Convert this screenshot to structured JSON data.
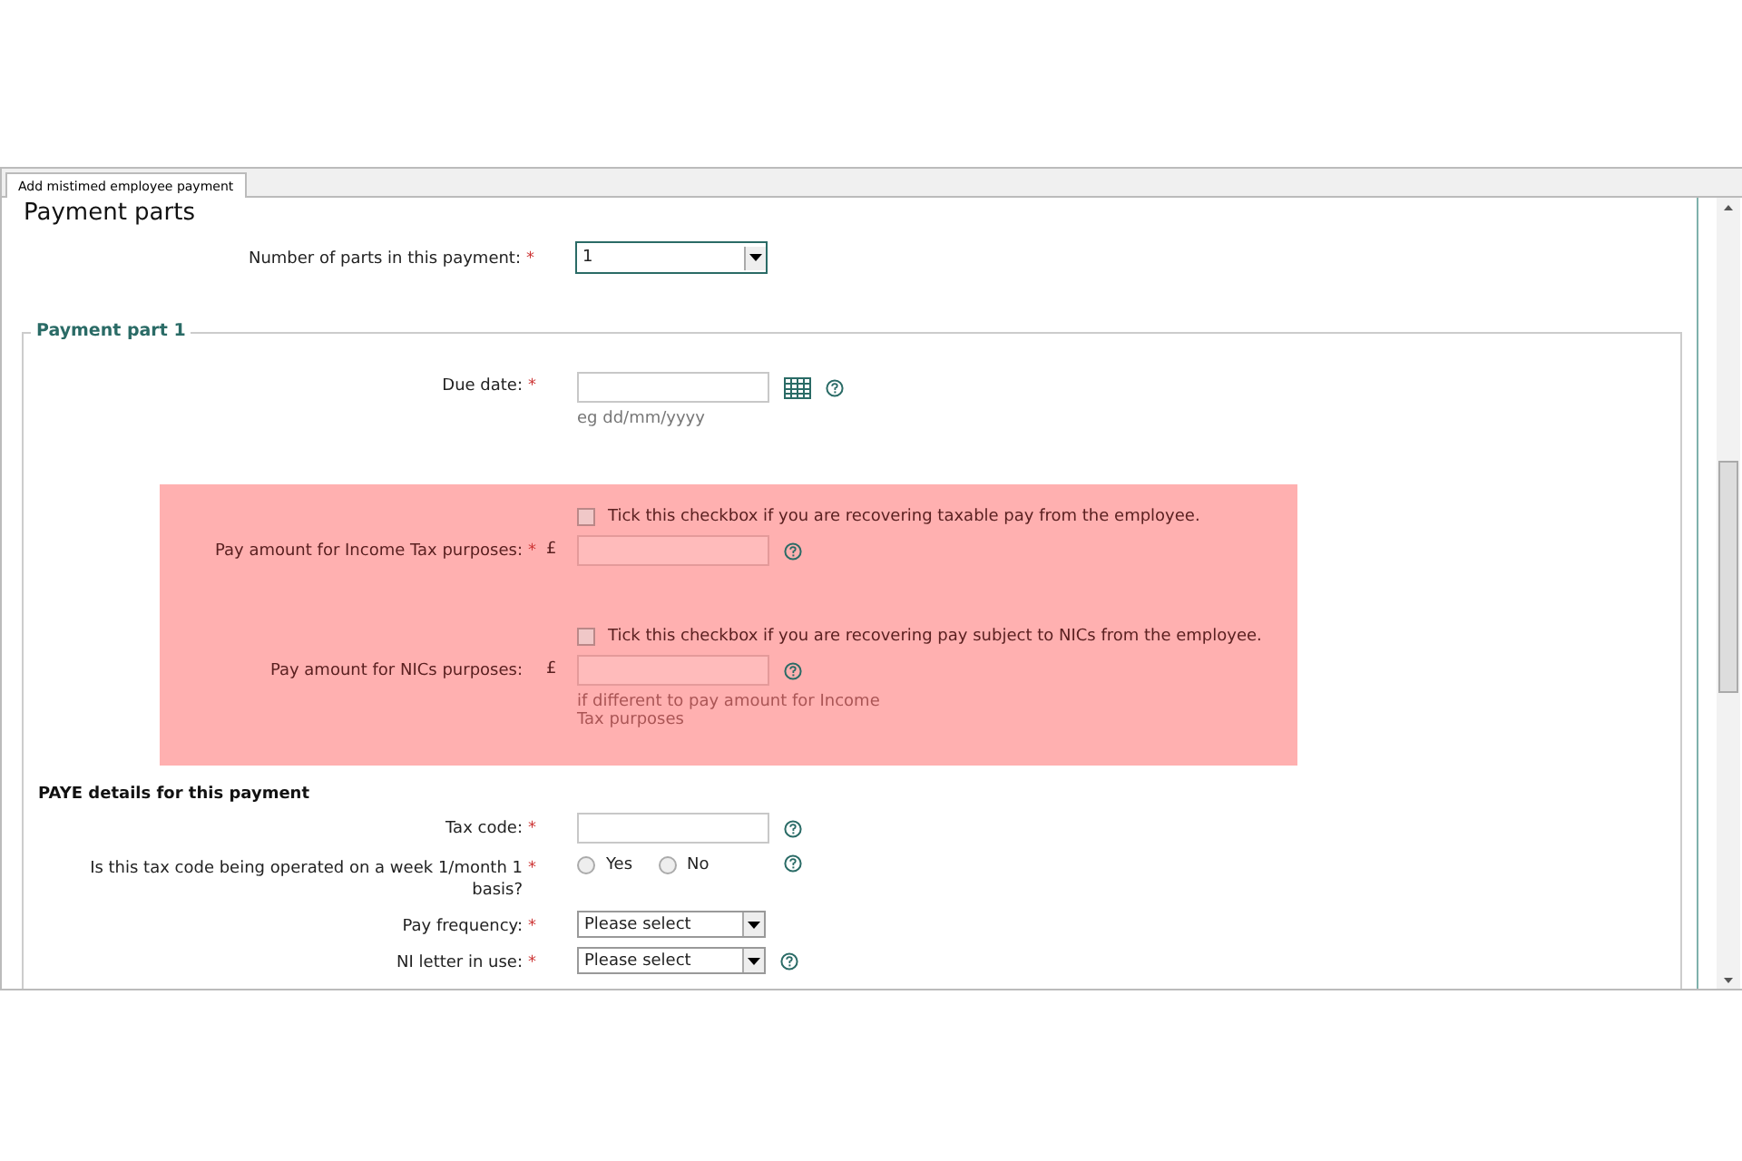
{
  "tab": {
    "label": "Add mistimed employee payment",
    "selected": true
  },
  "heading": "Payment parts",
  "parts_count": {
    "label": "Number of parts in this payment:",
    "required_mark": "*",
    "value": "1"
  },
  "payment_part": {
    "legend": "Payment part 1",
    "due_date": {
      "label": "Due date:",
      "required_mark": "*",
      "hint": "eg dd/mm/yyyy"
    },
    "pay_amounts": [
      {
        "checkbox_label": "Tick this checkbox if you are recovering taxable pay from the employee.",
        "checked": false,
        "label": "Pay amount for Income Tax purposes:",
        "required_mark": "*",
        "currency": "£"
      },
      {
        "checkbox_label": "Tick this checkbox if you are recovering pay subject to NICs from the employee.",
        "checked": false,
        "label": "Pay amount for NICs purposes:",
        "currency": "£",
        "hint": "if different to pay amount for Income Tax purposes"
      }
    ],
    "paye": {
      "heading": "PAYE details for this payment",
      "fields": [
        {
          "kind": "text",
          "label": "Tax code:",
          "required_mark": "*",
          "help": true
        },
        {
          "kind": "radio",
          "label": "Is this tax code being operated on a week 1/month 1 basis?",
          "required_mark": "*",
          "help": true,
          "options": [
            {
              "label": "Yes",
              "selected": false
            },
            {
              "label": "No",
              "selected": false
            }
          ]
        },
        {
          "kind": "select",
          "label": "Pay frequency:",
          "required_mark": "*",
          "value": "Please select",
          "help": false
        },
        {
          "kind": "select",
          "label": "NI letter in use:",
          "required_mark": "*",
          "value": "Please select",
          "help": true
        }
      ]
    }
  }
}
